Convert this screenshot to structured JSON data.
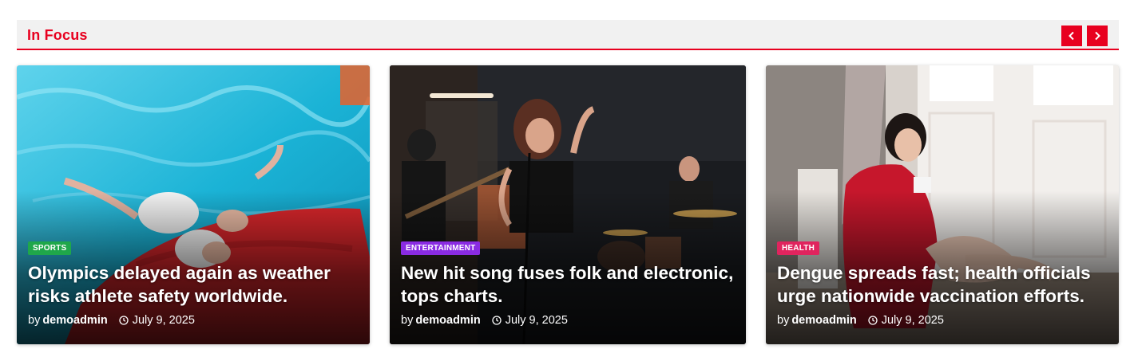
{
  "section": {
    "title": "In Focus",
    "accent_color": "#e8001f",
    "prev_icon": "chevron-left-icon",
    "next_icon": "chevron-right-icon"
  },
  "cards": [
    {
      "category": "SPORTS",
      "category_color": "#1fa74a",
      "title": "Olympics delayed again as weather risks athlete safety worldwide.",
      "by": "by",
      "author": "demoadmin",
      "date": "July 9, 2025",
      "image": "swimmers floating on backs in pool with white swim caps"
    },
    {
      "category": "ENTERTAINMENT",
      "category_color": "#8a2be2",
      "title": "New hit song fuses folk and electronic, tops charts.",
      "by": "by",
      "author": "demoadmin",
      "date": "July 9, 2025",
      "image": "band performing in dark studio, singer at microphone"
    },
    {
      "category": "HEALTH",
      "category_color": "#e0245e",
      "title": "Dengue spreads fast; health officials urge nationwide vaccination efforts.",
      "by": "by",
      "author": "demoadmin",
      "date": "July 9, 2025",
      "image": "sick woman wrapped in red blanket blowing nose"
    }
  ]
}
